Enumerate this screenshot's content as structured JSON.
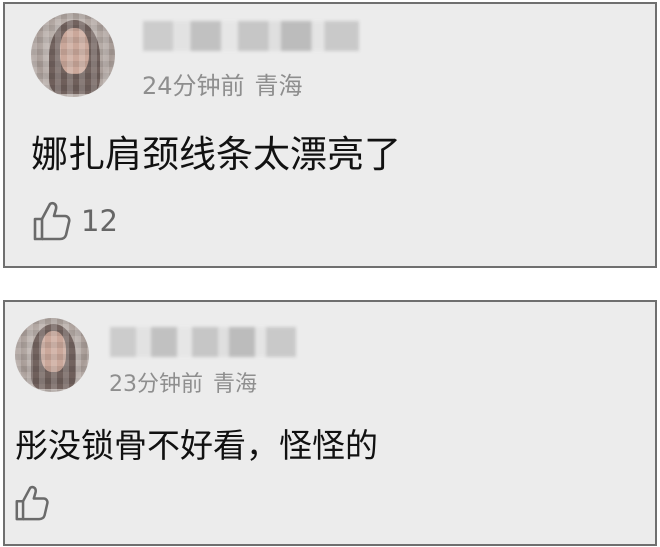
{
  "comments": [
    {
      "avatar_icon": "user-avatar-blurred",
      "time": "24分钟前",
      "location": "青海",
      "text": "娜扎肩颈线条太漂亮了",
      "like_icon": "thumbs-up-icon",
      "likes": "12"
    },
    {
      "avatar_icon": "user-avatar-blurred",
      "time": "23分钟前",
      "location": "青海",
      "text": "彤没锁骨不好看，怪怪的",
      "like_icon": "thumbs-up-icon",
      "likes": ""
    }
  ],
  "colors": {
    "card_bg": "#ececec",
    "card_border": "#6f6f6f",
    "meta_text": "#8e8e8e",
    "content_text": "#111111"
  }
}
